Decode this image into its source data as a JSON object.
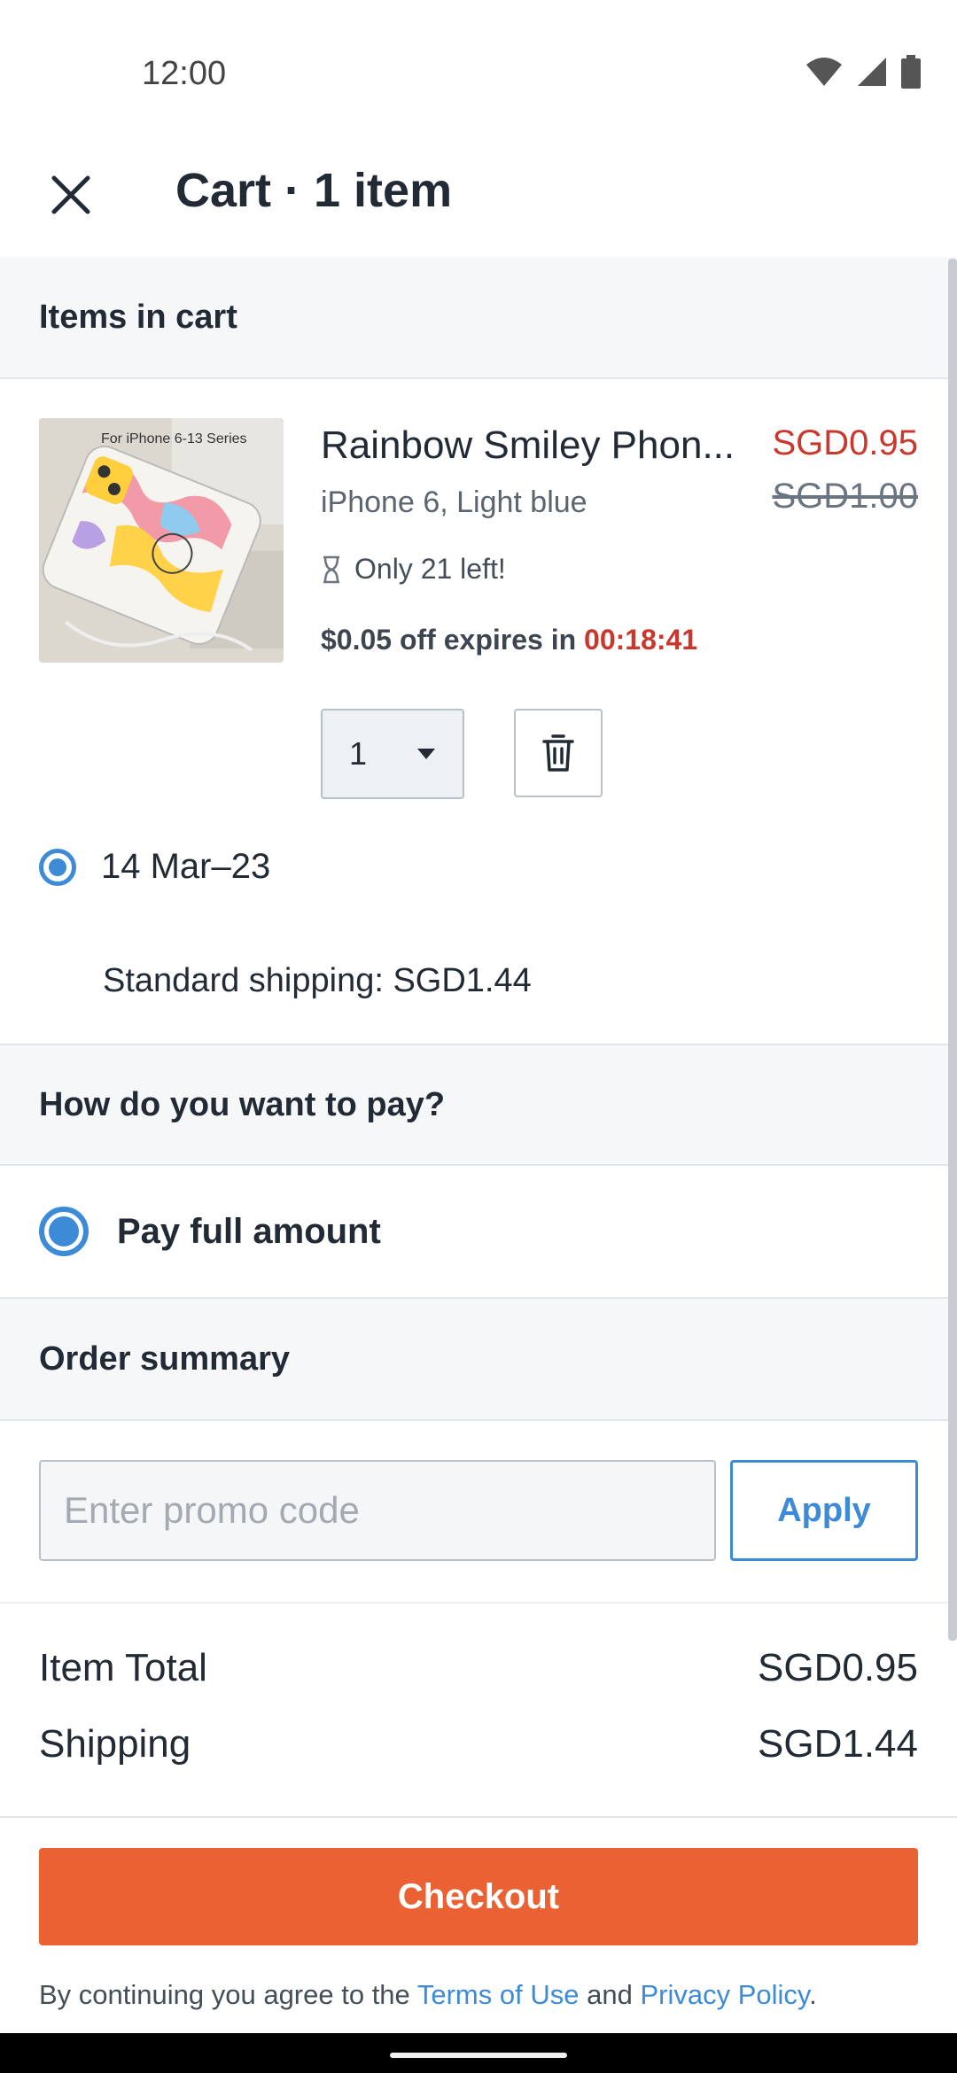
{
  "status_bar": {
    "time": "12:00"
  },
  "app_bar": {
    "title": "Cart · 1 item"
  },
  "cart": {
    "section_title": "Items in cart",
    "item": {
      "title": "Rainbow Smiley Phon...",
      "variant": "iPhone 6, Light blue",
      "price": "SGD0.95",
      "original_price": "SGD1.00",
      "stock": "Only 21 left!",
      "offer_prefix": "$0.05 off expires in",
      "offer_time": "00:18:41",
      "quantity": "1",
      "image_caption": "For iPhone 6-13 Series"
    },
    "delivery_dates": "14 Mar–23",
    "shipping_label": "Standard shipping: SGD1.44"
  },
  "payment": {
    "section_title": "How do you want to pay?",
    "option": "Pay full amount"
  },
  "order_summary": {
    "section_title": "Order summary",
    "promo_placeholder": "Enter promo code",
    "apply_label": "Apply",
    "rows": [
      {
        "label": "Item Total",
        "value": "SGD0.95"
      },
      {
        "label": "Shipping",
        "value": "SGD1.44"
      }
    ]
  },
  "footer": {
    "checkout_label": "Checkout",
    "legal_prefix": "By continuing you agree to the",
    "terms_link": "Terms of Use",
    "legal_and": "and",
    "privacy_link": "Privacy Policy",
    "legal_suffix": "."
  },
  "colors": {
    "accent": "#3d8bd6",
    "checkout": "#ea6234",
    "price_sale": "#c8382d"
  }
}
